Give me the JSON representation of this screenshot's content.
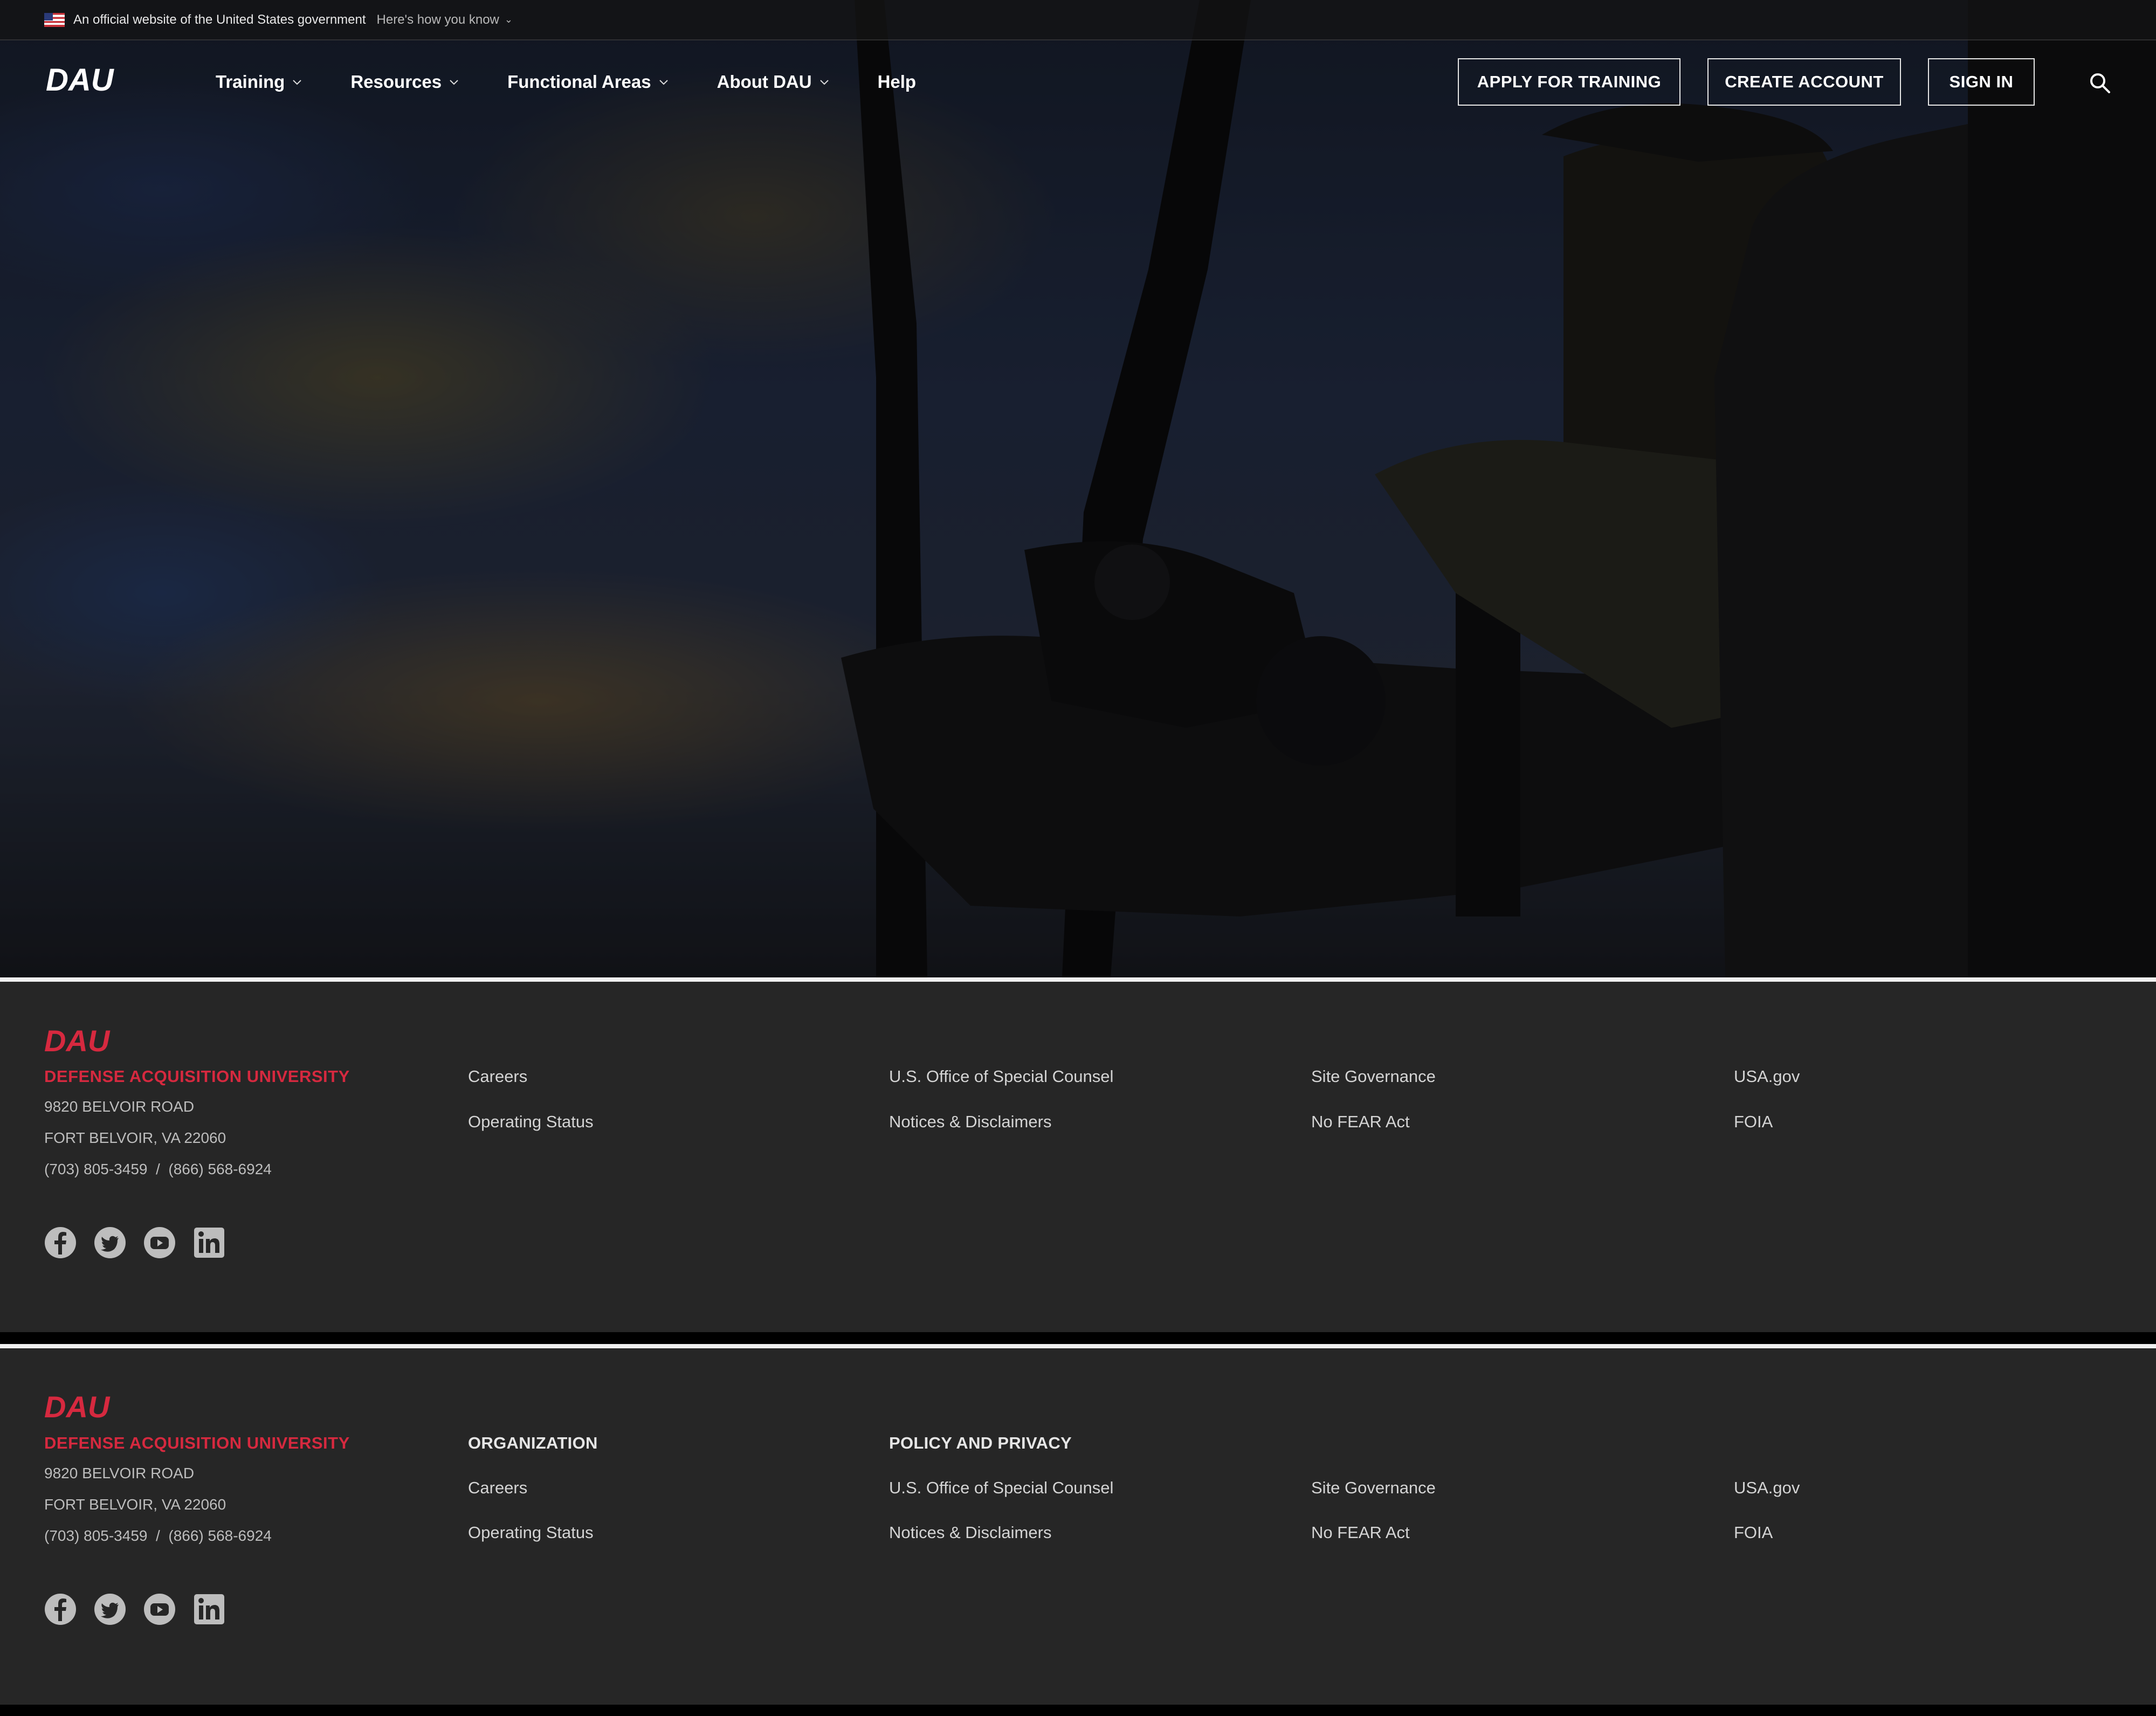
{
  "gov_banner": {
    "text": "An official website of the United States government",
    "link": "Here's how you know"
  },
  "nav": {
    "logo": "DAU",
    "menu": [
      {
        "label": "Training",
        "has_dropdown": true
      },
      {
        "label": "Resources",
        "has_dropdown": true
      },
      {
        "label": "Functional Areas",
        "has_dropdown": true
      },
      {
        "label": "About DAU",
        "has_dropdown": true
      },
      {
        "label": "Help",
        "has_dropdown": false
      }
    ],
    "buttons": {
      "apply": "APPLY FOR TRAINING",
      "create": "CREATE ACCOUNT",
      "signin": "SIGN IN"
    },
    "search_icon": "search-icon"
  },
  "footer1": {
    "logo": "DAU",
    "university": "DEFENSE ACQUISITION UNIVERSITY",
    "address1": "9820 BELVOIR ROAD",
    "address2": "FORT BELVOIR, VA 22060",
    "phone": "(703) 805-3459  /  (866) 568-6924",
    "links": {
      "careers": "Careers",
      "operating_status": "Operating Status",
      "osc": "U.S. Office of Special Counsel",
      "notices": "Notices & Disclaimers",
      "governance": "Site Governance",
      "no_fear": "No FEAR Act",
      "usagov": "USA.gov",
      "foia": "FOIA"
    },
    "social": [
      "facebook-icon",
      "twitter-icon",
      "youtube-icon",
      "linkedin-icon"
    ]
  },
  "footer2": {
    "logo": "DAU",
    "university": "DEFENSE ACQUISITION UNIVERSITY",
    "address1": "9820 BELVOIR ROAD",
    "address2": "FORT BELVOIR, VA 22060",
    "phone": "(703) 805-3459  /  (866) 568-6924",
    "headings": {
      "organization": "ORGANIZATION",
      "policy": "POLICY AND PRIVACY"
    },
    "links": {
      "careers": "Careers",
      "operating_status": "Operating Status",
      "osc": "U.S. Office of Special Counsel",
      "notices": "Notices & Disclaimers",
      "governance": "Site Governance",
      "no_fear": "No FEAR Act",
      "usagov": "USA.gov",
      "foia": "FOIA"
    },
    "social": [
      "facebook-icon",
      "twitter-icon",
      "youtube-icon",
      "linkedin-icon"
    ]
  },
  "colors": {
    "brand_red": "#d6293f",
    "footer_bg": "#262626"
  }
}
